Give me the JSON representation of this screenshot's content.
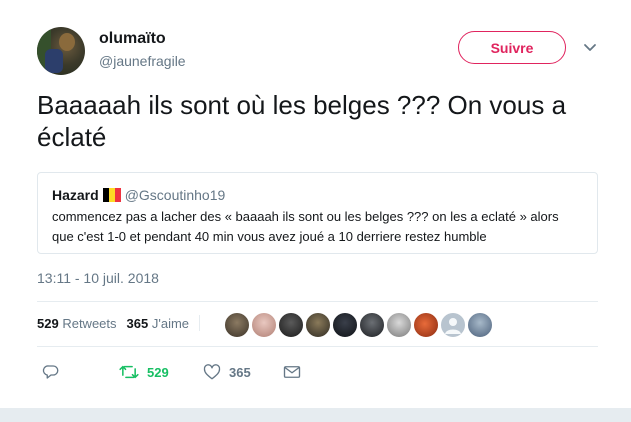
{
  "author": {
    "display_name": "olumaïto",
    "handle": "@jaunefragile",
    "follow_label": "Suivre"
  },
  "tweet": {
    "text": "Baaaaah ils sont où les belges ??? On vous a éclaté",
    "timestamp": "13:11 - 10 juil. 2018"
  },
  "quoted": {
    "name": "Hazard",
    "handle": "@Gscoutinho19",
    "text": "commencez pas a lacher des « baaaah ils sont ou les belges ??? on les a eclaté » alors que c'est 1-0 et pendant 40 min vous avez joué a 10 derriere restez humble"
  },
  "stats": {
    "retweets_count": "529",
    "retweets_label": "Retweets",
    "likes_count": "365",
    "likes_label": "J'aime"
  },
  "actions": {
    "retweet_count": "529",
    "like_count": "365"
  },
  "colors": {
    "follow_accent": "#e0245e",
    "retweet_active": "#17bf63",
    "muted_text": "#657786",
    "belgium_flag": [
      "#000000",
      "#fdda24",
      "#ef3340"
    ]
  },
  "icons": {
    "reply": "reply-icon",
    "retweet": "retweet-icon",
    "like": "heart-icon",
    "dm": "envelope-icon",
    "menu": "chevron-down-icon"
  }
}
